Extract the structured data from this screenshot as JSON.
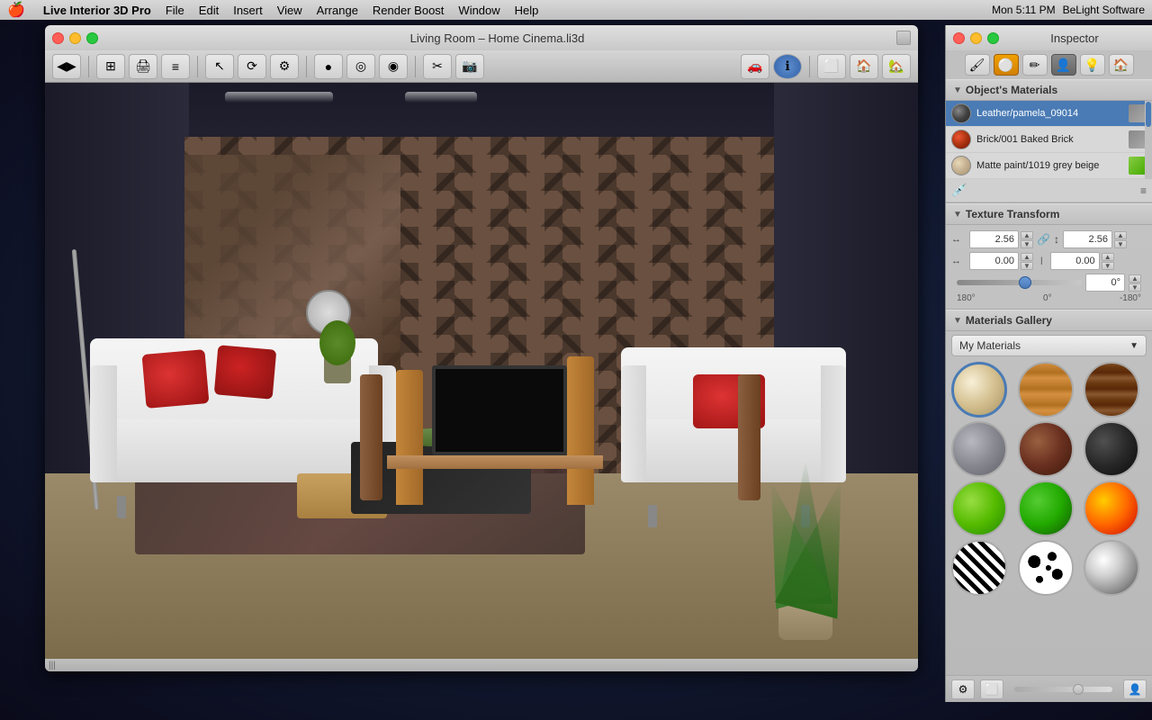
{
  "menubar": {
    "apple": "🍎",
    "items": [
      "Live Interior 3D Pro",
      "File",
      "Edit",
      "Insert",
      "View",
      "Arrange",
      "Render Boost",
      "Window",
      "Help"
    ],
    "right": {
      "time": "Mon 5:11 PM",
      "brand": "BeLight Software"
    }
  },
  "window": {
    "title": "Living Room – Home Cinema.li3d",
    "traffic_lights": [
      "close",
      "minimize",
      "maximize"
    ]
  },
  "toolbar": {
    "buttons": [
      "◀▶",
      "⊞",
      "🖨",
      "≡",
      "↖",
      "⟳",
      "⚙",
      "●",
      "◎",
      "◉",
      "✂",
      "📷",
      "🚗",
      "ℹ",
      "⬜",
      "🏠",
      "🏠+"
    ]
  },
  "inspector": {
    "title": "Inspector",
    "tabs": [
      "paint",
      "sphere",
      "pencil",
      "person",
      "lightbulb",
      "house"
    ],
    "objects_materials": {
      "label": "Object's Materials",
      "materials": [
        {
          "name": "Leather/pamela_09014",
          "color": "#4a4a4a",
          "type": "texture"
        },
        {
          "name": "Brick/001 Baked Brick",
          "color": "#cc3300",
          "type": "texture"
        },
        {
          "name": "Matte paint/1019 grey beige",
          "color": "#d4c4a8",
          "type": "texture"
        }
      ],
      "scrollbar_visible": true
    },
    "texture_transform": {
      "label": "Texture Transform",
      "width_label": "↔",
      "height_label": "↕",
      "width_value": "2.56",
      "height_value": "2.56",
      "offset_x_label": "↔",
      "offset_y_label": "↕",
      "offset_x_value": "0.00",
      "offset_y_value": "0.00",
      "rotation_value": "0°",
      "rotation_min": "180°",
      "rotation_center": "0°",
      "rotation_max": "-180°"
    },
    "materials_gallery": {
      "label": "Materials Gallery",
      "dropdown_value": "My Materials",
      "materials": [
        {
          "id": "beige",
          "style": "mat-beige",
          "selected": true
        },
        {
          "id": "wood-light",
          "style": "mat-wood-light",
          "selected": false
        },
        {
          "id": "wood-dark",
          "style": "mat-wood-dark",
          "selected": false
        },
        {
          "id": "concrete",
          "style": "mat-concrete",
          "selected": false
        },
        {
          "id": "brown-leather",
          "style": "mat-brown-leather",
          "selected": false
        },
        {
          "id": "dark-metal",
          "style": "mat-dark-metal",
          "selected": false
        },
        {
          "id": "green",
          "style": "mat-green",
          "selected": false
        },
        {
          "id": "green2",
          "style": "mat-green2",
          "selected": false
        },
        {
          "id": "fire",
          "style": "mat-fire",
          "selected": false
        },
        {
          "id": "zebra",
          "style": "mat-zebra",
          "selected": false
        },
        {
          "id": "dalmatian",
          "style": "mat-dalmatian",
          "selected": false
        },
        {
          "id": "chrome",
          "style": "mat-chrome",
          "selected": false
        }
      ]
    }
  }
}
